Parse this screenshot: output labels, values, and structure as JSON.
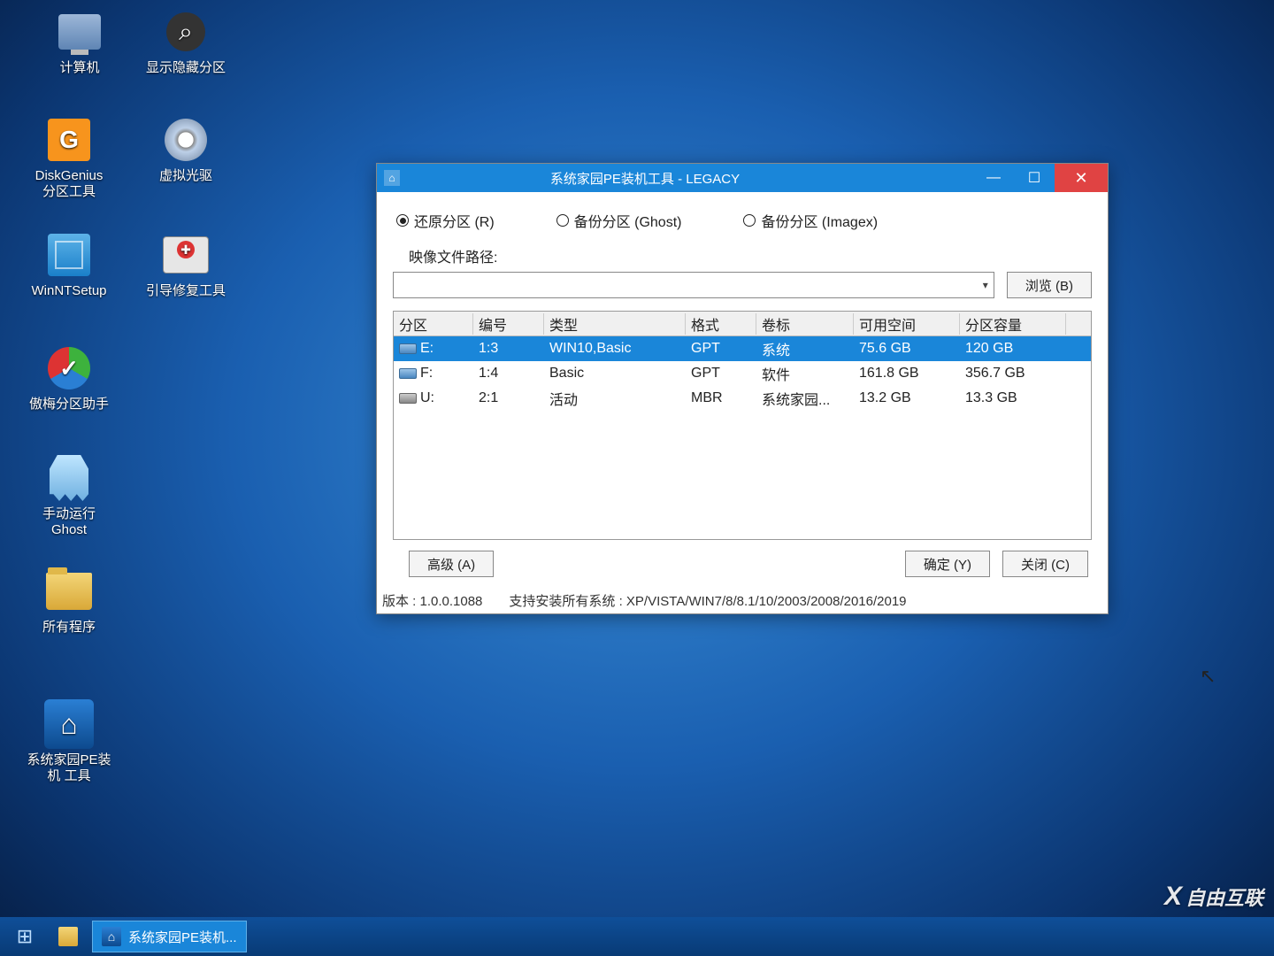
{
  "desktop_icons": [
    {
      "name": "computer",
      "label": "计算机"
    },
    {
      "name": "show-hidden-partition",
      "label": "显示隐藏分区"
    },
    {
      "name": "diskgenius",
      "label": "DiskGenius\n分区工具"
    },
    {
      "name": "virtual-cd",
      "label": "虚拟光驱"
    },
    {
      "name": "winntsetup",
      "label": "WinNTSetup"
    },
    {
      "name": "boot-repair",
      "label": "引导修复工具"
    },
    {
      "name": "aomei",
      "label": "傲梅分区助手"
    },
    {
      "name": "ghost",
      "label": "手动运行\nGhost"
    },
    {
      "name": "all-programs",
      "label": "所有程序"
    },
    {
      "name": "pe-installer",
      "label": "系统家园PE装\n机 工具"
    }
  ],
  "window": {
    "title": "系统家园PE装机工具 - LEGACY",
    "radios": {
      "restore": "还原分区 (R)",
      "backup_ghost": "备份分区 (Ghost)",
      "backup_imagex": "备份分区 (Imagex)"
    },
    "path_label": "映像文件路径:",
    "browse_btn": "浏览 (B)",
    "table": {
      "headers": {
        "partition": "分区",
        "no": "编号",
        "type": "类型",
        "format": "格式",
        "volume": "卷标",
        "free": "可用空间",
        "size": "分区容量"
      },
      "rows": [
        {
          "drive": "E:",
          "no": "1:3",
          "type": "WIN10,Basic",
          "format": "GPT",
          "volume": "系统",
          "free": "75.6 GB",
          "size": "120 GB",
          "selected": true,
          "usb": false
        },
        {
          "drive": "F:",
          "no": "1:4",
          "type": "Basic",
          "format": "GPT",
          "volume": "软件",
          "free": "161.8 GB",
          "size": "356.7 GB",
          "selected": false,
          "usb": false
        },
        {
          "drive": "U:",
          "no": "2:1",
          "type": "活动",
          "format": "MBR",
          "volume": "系统家园...",
          "free": "13.2 GB",
          "size": "13.3 GB",
          "selected": false,
          "usb": true
        }
      ]
    },
    "advanced_btn": "高级 (A)",
    "ok_btn": "确定 (Y)",
    "close_btn": "关闭 (C)",
    "version": "版本 : 1.0.0.1088",
    "support": "支持安装所有系统 : XP/VISTA/WIN7/8/8.1/10/2003/2008/2016/2019"
  },
  "taskbar": {
    "app_label": "系统家园PE装机..."
  },
  "watermark": "自由互联"
}
